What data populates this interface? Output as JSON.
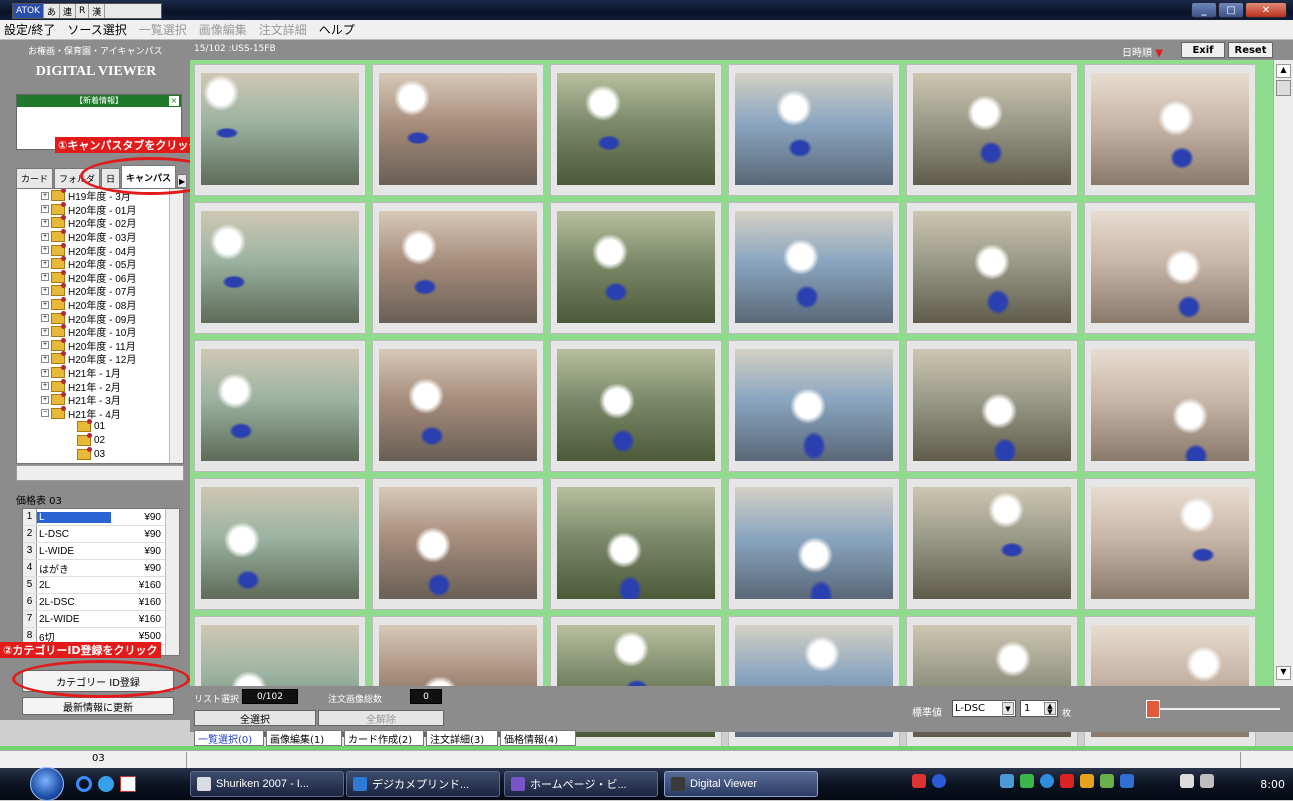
{
  "titlebar": {
    "ime_labels": [
      "ATOK",
      "あ",
      "連",
      "R",
      "漢"
    ]
  },
  "menu": [
    {
      "label": "設定/終了",
      "enabled": true
    },
    {
      "label": "ソース選択",
      "enabled": true
    },
    {
      "label": "一覧選択",
      "enabled": false
    },
    {
      "label": "画像編集",
      "enabled": false
    },
    {
      "label": "注文詳細",
      "enabled": false
    },
    {
      "label": "ヘルプ",
      "enabled": true
    }
  ],
  "header": {
    "crumbs": "お権画・保育園・アイキャンパス",
    "path": "15/102 :USS-15FB",
    "sort_label": "日時順",
    "sort_arrow": "▼",
    "exif_label": "Exif",
    "reset_label": "Reset"
  },
  "left": {
    "logo": "DIGITAL VIEWER",
    "news_title": "【新着情報】",
    "tabs": [
      "カード",
      "フォルダ",
      "日",
      "キャンパス"
    ],
    "tree": [
      {
        "label": "H19年度 - 3月",
        "type": "year"
      },
      {
        "label": "H20年度 - 01月",
        "type": "year"
      },
      {
        "label": "H20年度 - 02月",
        "type": "year"
      },
      {
        "label": "H20年度 - 03月",
        "type": "year"
      },
      {
        "label": "H20年度 - 04月",
        "type": "year"
      },
      {
        "label": "H20年度 - 05月",
        "type": "year"
      },
      {
        "label": "H20年度 - 06月",
        "type": "year"
      },
      {
        "label": "H20年度 - 07月",
        "type": "year"
      },
      {
        "label": "H20年度 - 08月",
        "type": "year"
      },
      {
        "label": "H20年度 - 09月",
        "type": "year"
      },
      {
        "label": "H20年度 - 10月",
        "type": "year"
      },
      {
        "label": "H20年度 - 11月",
        "type": "year"
      },
      {
        "label": "H20年度 - 12月",
        "type": "year"
      },
      {
        "label": "H21年 - 1月",
        "type": "year"
      },
      {
        "label": "H21年 - 2月",
        "type": "year"
      },
      {
        "label": "H21年 - 3月",
        "type": "year"
      },
      {
        "label": "H21年 - 4月",
        "type": "year"
      },
      {
        "label": "01",
        "type": "child"
      },
      {
        "label": "02",
        "type": "child"
      },
      {
        "label": "03",
        "type": "child"
      }
    ],
    "price_header": "価格表 03",
    "prices": [
      {
        "num": "1",
        "name": "L",
        "price": "¥90"
      },
      {
        "num": "2",
        "name": "L-DSC",
        "price": "¥90"
      },
      {
        "num": "3",
        "name": "L-WIDE",
        "price": "¥90"
      },
      {
        "num": "4",
        "name": "はがき",
        "price": "¥90"
      },
      {
        "num": "5",
        "name": "2L",
        "price": "¥160"
      },
      {
        "num": "6",
        "name": "2L-DSC",
        "price": "¥160"
      },
      {
        "num": "7",
        "name": "2L-WIDE",
        "price": "¥160"
      },
      {
        "num": "8",
        "name": "6切",
        "price": "¥500"
      }
    ],
    "category_button": "カテゴリー ID登録",
    "update_button": "最新情報に更新"
  },
  "annotations": {
    "step1": "①キャンパスタブをクリック",
    "step2": "②カテゴリーID登録をクリック"
  },
  "bottom": {
    "list_select_label": "リスト選択",
    "list_select_value": "0/102",
    "order_count_label": "注文画像総数",
    "order_count_value": "0",
    "select_all": "全選択",
    "deselect_all": "全解除",
    "standard_label": "標準値",
    "size_value": "L-DSC",
    "qty_value": "1",
    "qty_unit": "枚",
    "tabs": [
      "一覧選択(0)",
      "画像編集(1)",
      "カード作成(2)",
      "注文詳細(3)",
      "価格情報(4)"
    ]
  },
  "status": {
    "left_text": "03"
  },
  "taskbar": {
    "items": [
      "Shuriken 2007 - I...",
      "デジカメプリンド...",
      "ホームページ・ビ...",
      "Digital Viewer"
    ],
    "clock": "8:00"
  },
  "colors": {
    "grid_green": "#8fdc8f",
    "annotation_red": "#e31a1a",
    "panel_gray": "#8c8c8c"
  }
}
